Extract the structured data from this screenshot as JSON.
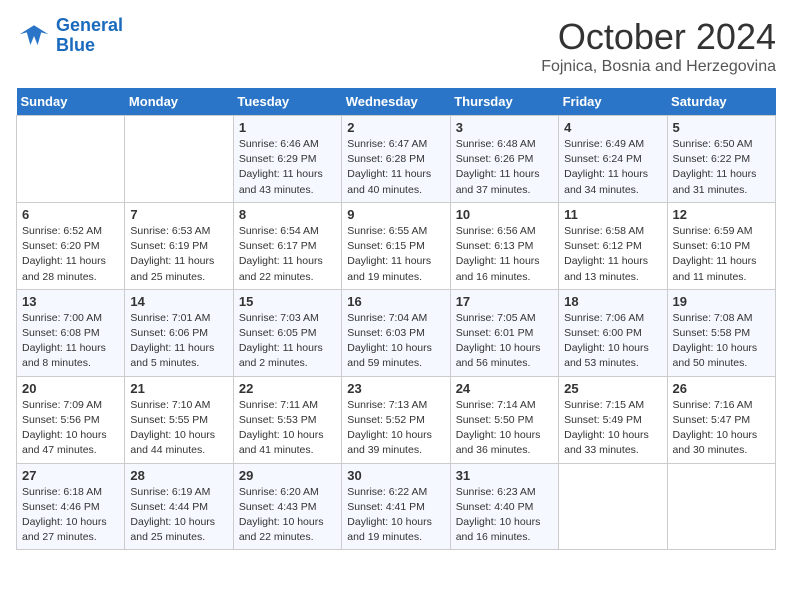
{
  "header": {
    "logo_line1": "General",
    "logo_line2": "Blue",
    "month": "October 2024",
    "location": "Fojnica, Bosnia and Herzegovina"
  },
  "days_of_week": [
    "Sunday",
    "Monday",
    "Tuesday",
    "Wednesday",
    "Thursday",
    "Friday",
    "Saturday"
  ],
  "weeks": [
    [
      {
        "day": "",
        "sunrise": "",
        "sunset": "",
        "daylight": ""
      },
      {
        "day": "",
        "sunrise": "",
        "sunset": "",
        "daylight": ""
      },
      {
        "day": "1",
        "sunrise": "Sunrise: 6:46 AM",
        "sunset": "Sunset: 6:29 PM",
        "daylight": "Daylight: 11 hours and 43 minutes."
      },
      {
        "day": "2",
        "sunrise": "Sunrise: 6:47 AM",
        "sunset": "Sunset: 6:28 PM",
        "daylight": "Daylight: 11 hours and 40 minutes."
      },
      {
        "day": "3",
        "sunrise": "Sunrise: 6:48 AM",
        "sunset": "Sunset: 6:26 PM",
        "daylight": "Daylight: 11 hours and 37 minutes."
      },
      {
        "day": "4",
        "sunrise": "Sunrise: 6:49 AM",
        "sunset": "Sunset: 6:24 PM",
        "daylight": "Daylight: 11 hours and 34 minutes."
      },
      {
        "day": "5",
        "sunrise": "Sunrise: 6:50 AM",
        "sunset": "Sunset: 6:22 PM",
        "daylight": "Daylight: 11 hours and 31 minutes."
      }
    ],
    [
      {
        "day": "6",
        "sunrise": "Sunrise: 6:52 AM",
        "sunset": "Sunset: 6:20 PM",
        "daylight": "Daylight: 11 hours and 28 minutes."
      },
      {
        "day": "7",
        "sunrise": "Sunrise: 6:53 AM",
        "sunset": "Sunset: 6:19 PM",
        "daylight": "Daylight: 11 hours and 25 minutes."
      },
      {
        "day": "8",
        "sunrise": "Sunrise: 6:54 AM",
        "sunset": "Sunset: 6:17 PM",
        "daylight": "Daylight: 11 hours and 22 minutes."
      },
      {
        "day": "9",
        "sunrise": "Sunrise: 6:55 AM",
        "sunset": "Sunset: 6:15 PM",
        "daylight": "Daylight: 11 hours and 19 minutes."
      },
      {
        "day": "10",
        "sunrise": "Sunrise: 6:56 AM",
        "sunset": "Sunset: 6:13 PM",
        "daylight": "Daylight: 11 hours and 16 minutes."
      },
      {
        "day": "11",
        "sunrise": "Sunrise: 6:58 AM",
        "sunset": "Sunset: 6:12 PM",
        "daylight": "Daylight: 11 hours and 13 minutes."
      },
      {
        "day": "12",
        "sunrise": "Sunrise: 6:59 AM",
        "sunset": "Sunset: 6:10 PM",
        "daylight": "Daylight: 11 hours and 11 minutes."
      }
    ],
    [
      {
        "day": "13",
        "sunrise": "Sunrise: 7:00 AM",
        "sunset": "Sunset: 6:08 PM",
        "daylight": "Daylight: 11 hours and 8 minutes."
      },
      {
        "day": "14",
        "sunrise": "Sunrise: 7:01 AM",
        "sunset": "Sunset: 6:06 PM",
        "daylight": "Daylight: 11 hours and 5 minutes."
      },
      {
        "day": "15",
        "sunrise": "Sunrise: 7:03 AM",
        "sunset": "Sunset: 6:05 PM",
        "daylight": "Daylight: 11 hours and 2 minutes."
      },
      {
        "day": "16",
        "sunrise": "Sunrise: 7:04 AM",
        "sunset": "Sunset: 6:03 PM",
        "daylight": "Daylight: 10 hours and 59 minutes."
      },
      {
        "day": "17",
        "sunrise": "Sunrise: 7:05 AM",
        "sunset": "Sunset: 6:01 PM",
        "daylight": "Daylight: 10 hours and 56 minutes."
      },
      {
        "day": "18",
        "sunrise": "Sunrise: 7:06 AM",
        "sunset": "Sunset: 6:00 PM",
        "daylight": "Daylight: 10 hours and 53 minutes."
      },
      {
        "day": "19",
        "sunrise": "Sunrise: 7:08 AM",
        "sunset": "Sunset: 5:58 PM",
        "daylight": "Daylight: 10 hours and 50 minutes."
      }
    ],
    [
      {
        "day": "20",
        "sunrise": "Sunrise: 7:09 AM",
        "sunset": "Sunset: 5:56 PM",
        "daylight": "Daylight: 10 hours and 47 minutes."
      },
      {
        "day": "21",
        "sunrise": "Sunrise: 7:10 AM",
        "sunset": "Sunset: 5:55 PM",
        "daylight": "Daylight: 10 hours and 44 minutes."
      },
      {
        "day": "22",
        "sunrise": "Sunrise: 7:11 AM",
        "sunset": "Sunset: 5:53 PM",
        "daylight": "Daylight: 10 hours and 41 minutes."
      },
      {
        "day": "23",
        "sunrise": "Sunrise: 7:13 AM",
        "sunset": "Sunset: 5:52 PM",
        "daylight": "Daylight: 10 hours and 39 minutes."
      },
      {
        "day": "24",
        "sunrise": "Sunrise: 7:14 AM",
        "sunset": "Sunset: 5:50 PM",
        "daylight": "Daylight: 10 hours and 36 minutes."
      },
      {
        "day": "25",
        "sunrise": "Sunrise: 7:15 AM",
        "sunset": "Sunset: 5:49 PM",
        "daylight": "Daylight: 10 hours and 33 minutes."
      },
      {
        "day": "26",
        "sunrise": "Sunrise: 7:16 AM",
        "sunset": "Sunset: 5:47 PM",
        "daylight": "Daylight: 10 hours and 30 minutes."
      }
    ],
    [
      {
        "day": "27",
        "sunrise": "Sunrise: 6:18 AM",
        "sunset": "Sunset: 4:46 PM",
        "daylight": "Daylight: 10 hours and 27 minutes."
      },
      {
        "day": "28",
        "sunrise": "Sunrise: 6:19 AM",
        "sunset": "Sunset: 4:44 PM",
        "daylight": "Daylight: 10 hours and 25 minutes."
      },
      {
        "day": "29",
        "sunrise": "Sunrise: 6:20 AM",
        "sunset": "Sunset: 4:43 PM",
        "daylight": "Daylight: 10 hours and 22 minutes."
      },
      {
        "day": "30",
        "sunrise": "Sunrise: 6:22 AM",
        "sunset": "Sunset: 4:41 PM",
        "daylight": "Daylight: 10 hours and 19 minutes."
      },
      {
        "day": "31",
        "sunrise": "Sunrise: 6:23 AM",
        "sunset": "Sunset: 4:40 PM",
        "daylight": "Daylight: 10 hours and 16 minutes."
      },
      {
        "day": "",
        "sunrise": "",
        "sunset": "",
        "daylight": ""
      },
      {
        "day": "",
        "sunrise": "",
        "sunset": "",
        "daylight": ""
      }
    ]
  ]
}
